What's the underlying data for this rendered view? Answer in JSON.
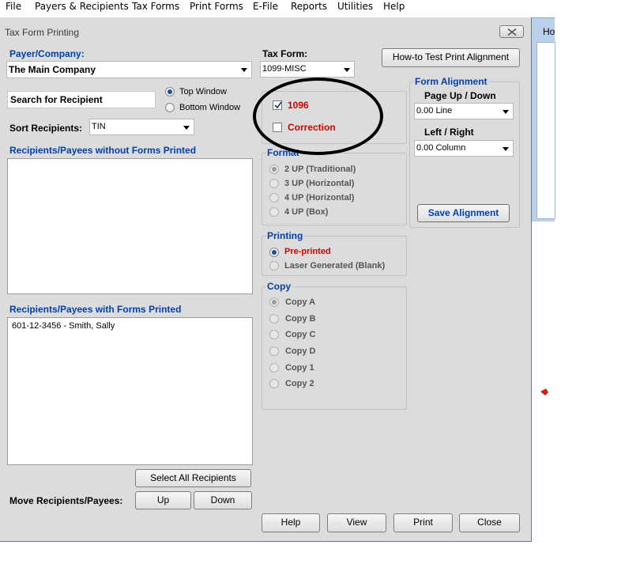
{
  "menu": [
    "File",
    "Payers & Recipients",
    "Tax Forms",
    "Print Forms",
    "E-File",
    "Reports",
    "Utilities",
    "Help"
  ],
  "background_window": {
    "title_fragment": "Ho"
  },
  "dialog": {
    "title": "Tax Form Printing",
    "payer_label": "Payer/Company:",
    "payer_value": "The Main Company",
    "tax_form_label": "Tax Form:",
    "tax_form_value": "1099-MISC",
    "how_to_button": "How-to Test Print  Alignment",
    "search_placeholder": "Search for Recipient",
    "window_options": [
      "Top Window",
      "Bottom Window"
    ],
    "window_selected": "Top Window",
    "sort_label": "Sort Recipients:",
    "sort_value": "TIN",
    "without_forms_label": "Recipients/Payees without Forms Printed",
    "with_forms_label": "Recipients/Payees with Forms Printed",
    "with_forms_items": [
      "601-12-3456 - Smith, Sally"
    ],
    "select_all_button": "Select All Recipients",
    "move_label": "Move Recipients/Payees:",
    "up_button": "Up",
    "down_button": "Down",
    "checkbox_1096": {
      "label": "1096",
      "checked": true
    },
    "checkbox_correction": {
      "label": "Correction",
      "checked": false
    },
    "format": {
      "caption": "Format",
      "options": [
        "2 UP (Traditional)",
        "3 UP (Horizontal)",
        "4 UP (Horizontal)",
        "4 UP (Box)"
      ],
      "selected": "2 UP (Traditional)"
    },
    "printing": {
      "caption": "Printing",
      "options": [
        "Pre-printed",
        "Laser Generated (Blank)"
      ],
      "selected": "Pre-printed"
    },
    "copy": {
      "caption": "Copy",
      "options": [
        "Copy A",
        "Copy B",
        "Copy C",
        "Copy D",
        "Copy 1",
        "Copy 2"
      ],
      "selected": "Copy A"
    },
    "alignment": {
      "caption": "Form Alignment",
      "page_label": "Page Up / Down",
      "page_value": "0.00 Line",
      "lr_label": "Left / Right",
      "lr_value": "0.00 Column",
      "save_button": "Save  Alignment"
    },
    "bottom_buttons": [
      "Help",
      "View",
      "Print",
      "Close"
    ]
  },
  "colors": {
    "label_blue": "#003fb0",
    "emphasis_red": "#d40000",
    "dialog_bg": "#dcdcdc",
    "annotation": "#000000"
  }
}
